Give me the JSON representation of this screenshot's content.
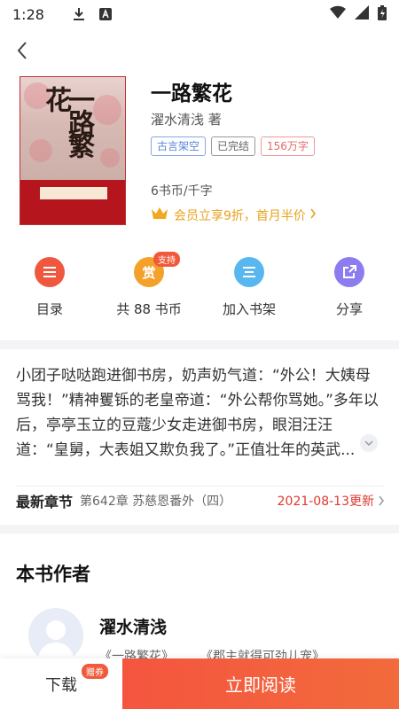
{
  "status_bar": {
    "time": "1:28"
  },
  "book": {
    "title": "一路繁花",
    "author": "濯水清浅 著",
    "tags": [
      "古言架空",
      "已完结",
      "156万字"
    ],
    "price": "6书币/千字",
    "vip_offer": "会员立享9折，首月半价"
  },
  "actions": [
    {
      "label": "目录",
      "color": "#f0573f",
      "icon": "menu-icon"
    },
    {
      "label": "共 88 书币",
      "color": "#f3a12a",
      "icon": "reward-icon",
      "icon_text": "赏",
      "badge": "支持"
    },
    {
      "label": "加入书架",
      "color": "#59b7f0",
      "icon": "bookshelf-icon"
    },
    {
      "label": "分享",
      "color": "#8b7cf0",
      "icon": "share-icon"
    }
  ],
  "synopsis": "小团子哒哒跑进御书房，奶声奶气道：“外公！大姨母骂我！”精神矍铄的老皇帝道：“外公帮你骂她。”多年以后，亭亭玉立的豆蔻少女走进御书房，眼泪汪汪道：“皇舅，大表姐又欺负我了。”正值壮年的英武...",
  "latest": {
    "label": "最新章节",
    "chapter": "第642章 苏慈恩番外（四）",
    "date": "2021-08-13更新"
  },
  "author_section": {
    "heading": "本书作者",
    "name": "濯水清浅",
    "works": [
      "《一路繁花》",
      "《郡主就得可劲儿宠》"
    ]
  },
  "bottom_bar": {
    "download": "下载",
    "download_badge": "赠券",
    "read": "立即阅读"
  }
}
